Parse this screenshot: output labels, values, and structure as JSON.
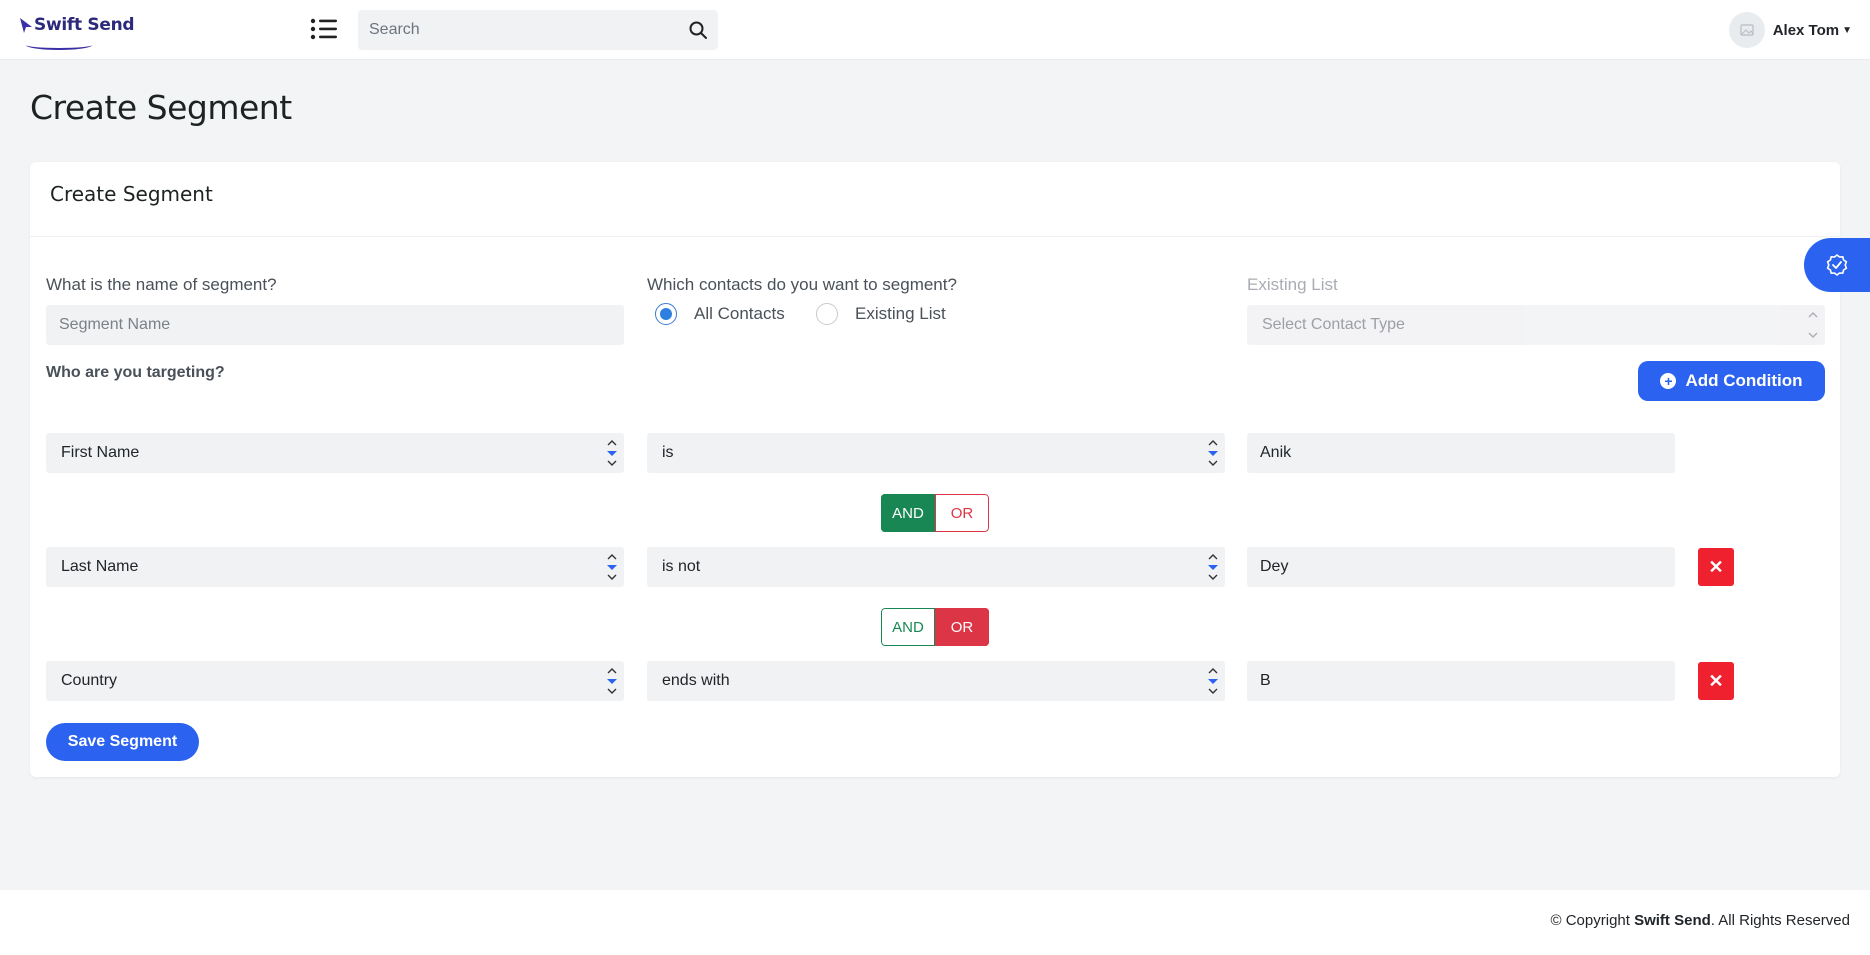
{
  "header": {
    "logo_text": "Swift Send",
    "search_placeholder": "Search",
    "user_name": "Alex Tom"
  },
  "page": {
    "title": "Create Segment"
  },
  "card": {
    "title": "Create Segment",
    "segment_name_label": "What is the name of segment?",
    "segment_name_placeholder": "Segment Name",
    "contacts_label": "Which contacts do you want to segment?",
    "radio_all": "All Contacts",
    "radio_existing": "Existing List",
    "selected_contacts": "All Contacts",
    "existing_list_label": "Existing List",
    "contact_type_placeholder": "Select Contact Type",
    "targeting_label": "Who are you targeting?",
    "add_condition": "Add Condition",
    "save_segment": "Save Segment"
  },
  "conditions": [
    {
      "field": "First Name",
      "operator": "is",
      "value": "Anik",
      "deletable": false
    },
    {
      "field": "Last Name",
      "operator": "is not",
      "value": "Dey",
      "deletable": true
    },
    {
      "field": "Country",
      "operator": "ends with",
      "value": "B",
      "deletable": true
    }
  ],
  "connectors": [
    {
      "and": "AND",
      "or": "OR",
      "selected": "AND"
    },
    {
      "and": "AND",
      "or": "OR",
      "selected": "OR"
    }
  ],
  "footer": {
    "prefix": "© Copyright",
    "brand": "Swift Send",
    "suffix": ". All Rights Reserved"
  },
  "colors": {
    "primary": "#2b63f0",
    "and_green": "#198754",
    "or_red": "#dc3545",
    "delete_red": "#f0212f"
  },
  "icons": [
    "menu-list-icon",
    "search-icon",
    "avatar-image-icon",
    "caret-down-icon",
    "plus-circle-icon",
    "close-icon",
    "badge-check-icon"
  ]
}
